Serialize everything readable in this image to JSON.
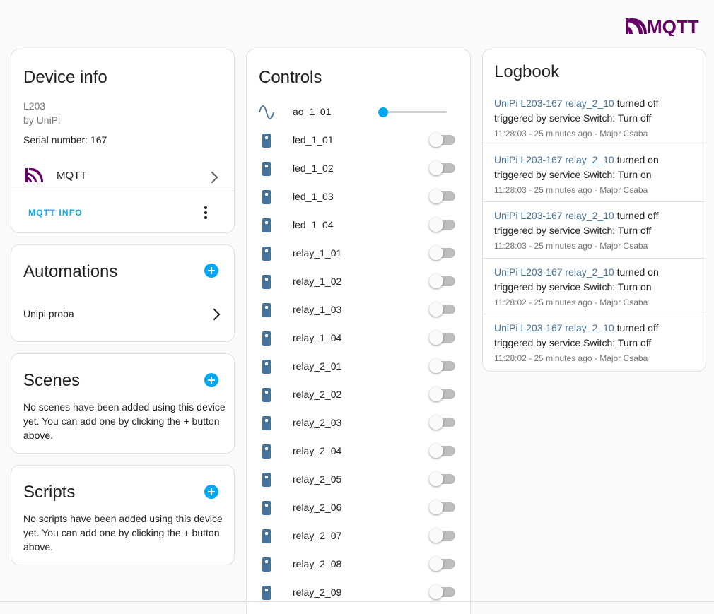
{
  "brand": {
    "logo_text": "MQTT",
    "color": "#660066"
  },
  "colors": {
    "accent": "#03a9f4",
    "entity_icon": "#44739e"
  },
  "device_info": {
    "title": "Device info",
    "model": "L203",
    "manufacturer": "by UniPi",
    "serial": "Serial number: 167",
    "integration": {
      "label": "MQTT",
      "icon": "mqtt-icon"
    },
    "action_label": "MQTT INFO"
  },
  "automations": {
    "title": "Automations",
    "items": [
      {
        "label": "Unipi proba"
      }
    ]
  },
  "scenes": {
    "title": "Scenes",
    "empty_text": "No scenes have been added using this device yet. You can add one by clicking the + button above."
  },
  "scripts": {
    "title": "Scripts",
    "empty_text": "No scripts have been added using this device yet. You can add one by clicking the + button above."
  },
  "controls": {
    "title": "Controls",
    "analog": {
      "label": "ao_1_01",
      "icon": "sine-wave-icon",
      "value_fraction": 0
    },
    "switches": [
      {
        "label": "led_1_01",
        "state": "off"
      },
      {
        "label": "led_1_02",
        "state": "off"
      },
      {
        "label": "led_1_03",
        "state": "off"
      },
      {
        "label": "led_1_04",
        "state": "off"
      },
      {
        "label": "relay_1_01",
        "state": "off"
      },
      {
        "label": "relay_1_02",
        "state": "off"
      },
      {
        "label": "relay_1_03",
        "state": "off"
      },
      {
        "label": "relay_1_04",
        "state": "off"
      },
      {
        "label": "relay_2_01",
        "state": "off"
      },
      {
        "label": "relay_2_02",
        "state": "off"
      },
      {
        "label": "relay_2_03",
        "state": "off"
      },
      {
        "label": "relay_2_04",
        "state": "off"
      },
      {
        "label": "relay_2_05",
        "state": "off"
      },
      {
        "label": "relay_2_06",
        "state": "off"
      },
      {
        "label": "relay_2_07",
        "state": "off"
      },
      {
        "label": "relay_2_08",
        "state": "off"
      },
      {
        "label": "relay_2_09",
        "state": "off"
      }
    ]
  },
  "logbook": {
    "title": "Logbook",
    "entries": [
      {
        "entity": "UniPi L203-167 relay_2_10",
        "action": " turned off",
        "trigger": "triggered by service Switch: Turn off",
        "time": "11:28:03",
        "relative": " - 25 minutes ago - ",
        "person": "Major Csaba"
      },
      {
        "entity": "UniPi L203-167 relay_2_10",
        "action": " turned on",
        "trigger": "triggered by service Switch: Turn on",
        "time": "11:28:03",
        "relative": " - 25 minutes ago - ",
        "person": "Major Csaba"
      },
      {
        "entity": "UniPi L203-167 relay_2_10",
        "action": " turned off",
        "trigger": "triggered by service Switch: Turn off",
        "time": "11:28:03",
        "relative": " - 25 minutes ago - ",
        "person": "Major Csaba"
      },
      {
        "entity": "UniPi L203-167 relay_2_10",
        "action": " turned on",
        "trigger": "triggered by service Switch: Turn on",
        "time": "11:28:02",
        "relative": " - 25 minutes ago - ",
        "person": "Major Csaba"
      },
      {
        "entity": "UniPi L203-167 relay_2_10",
        "action": " turned off",
        "trigger": "triggered by service Switch: Turn off",
        "time": "11:28:02",
        "relative": " - 25 minutes ago - ",
        "person": "Major Csaba"
      }
    ]
  }
}
